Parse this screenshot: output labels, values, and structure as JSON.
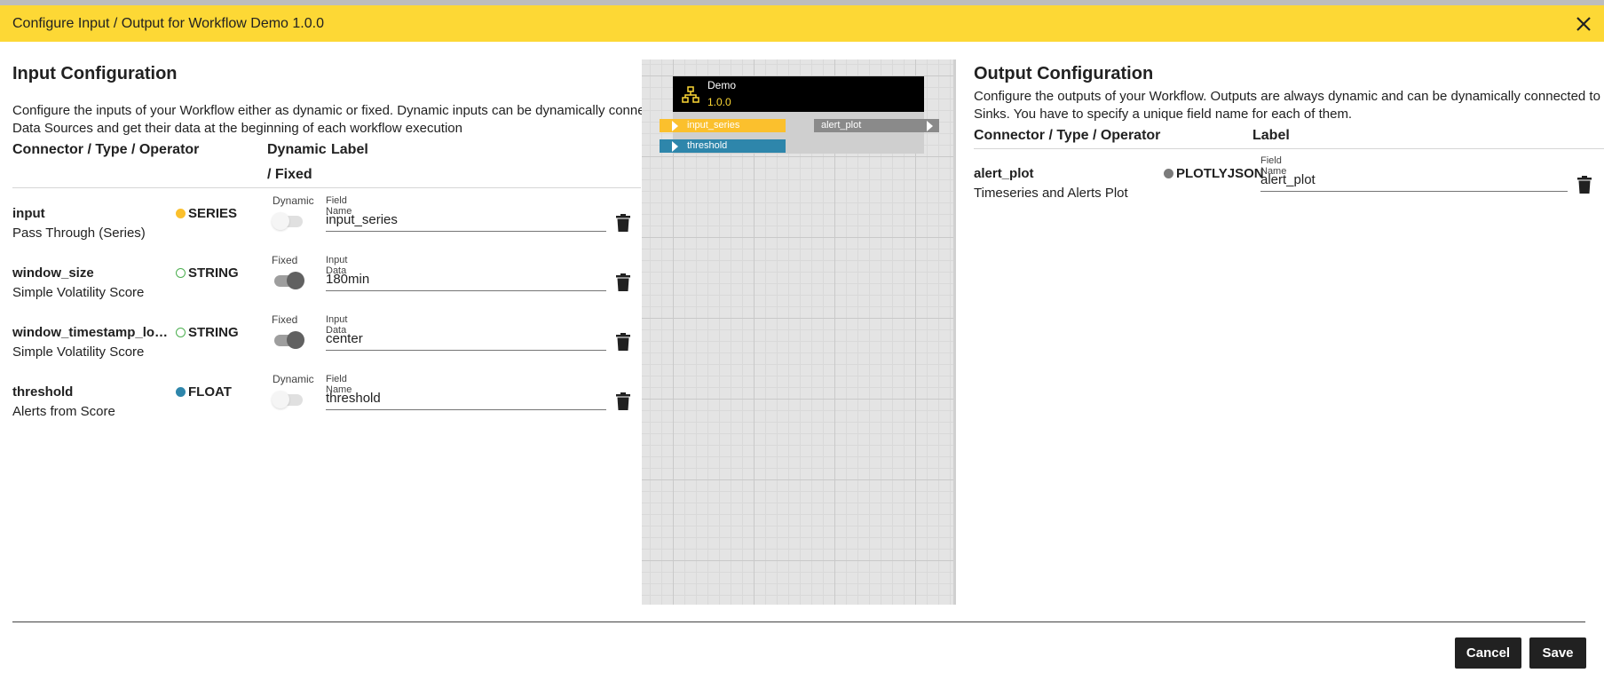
{
  "dialog": {
    "title": "Configure Input / Output for Workflow Demo 1.0.0"
  },
  "input_config": {
    "title": "Input Configuration",
    "description_line1": "Configure the inputs of your Workflow either as dynamic or fixed. Dynamic inputs can be dynamically connected to",
    "description_line2": "Data Sources and get their data at the beginning of each workflow execution",
    "headers": {
      "connector": "Connector / Type / Operator",
      "mode_line1": "Dynamic",
      "mode_line2": "/ Fixed",
      "label": "Label"
    },
    "rows": [
      {
        "name": "input",
        "operator": "Pass Through (Series)",
        "type": "SERIES",
        "type_color": "#fbc02d",
        "type_filled": true,
        "mode": "Dynamic",
        "mode_on": false,
        "field_label": "Field Name",
        "field_value": "input_series"
      },
      {
        "name": "window_size",
        "operator": "Simple Volatility Score",
        "type": "STRING",
        "type_color": "#4caf50",
        "type_filled": false,
        "mode": "Fixed",
        "mode_on": true,
        "field_label": "Input Data",
        "field_value": "180min"
      },
      {
        "name": "window_timestamp_locati...",
        "operator": "Simple Volatility Score",
        "type": "STRING",
        "type_color": "#4caf50",
        "type_filled": false,
        "mode": "Fixed",
        "mode_on": true,
        "field_label": "Input Data",
        "field_value": "center"
      },
      {
        "name": "threshold",
        "operator": "Alerts from Score",
        "type": "FLOAT",
        "type_color": "#2e86ab",
        "type_filled": true,
        "mode": "Dynamic",
        "mode_on": false,
        "field_label": "Field Name",
        "field_value": "threshold"
      }
    ]
  },
  "preview": {
    "node_name": "Demo",
    "node_version": "1.0.0",
    "inputs": [
      {
        "label": "input_series",
        "color": "#fbc02d"
      },
      {
        "label": "threshold",
        "color": "#2e86ab"
      }
    ],
    "outputs": [
      {
        "label": "alert_plot",
        "color": "#8a8a8a"
      }
    ]
  },
  "output_config": {
    "title": "Output Configuration",
    "description_line1": "Configure the outputs of your Workflow. Outputs are always dynamic and can be dynamically connected to Data",
    "description_line2": "Sinks. You have to specify a unique field name for each of them.",
    "headers": {
      "connector": "Connector / Type / Operator",
      "label": "Label"
    },
    "rows": [
      {
        "name": "alert_plot",
        "operator": "Timeseries and Alerts Plot",
        "type": "PLOTLYJSON",
        "type_color": "#7b7b7b",
        "type_filled": true,
        "field_label": "Field Name",
        "field_value": "alert_plot"
      }
    ]
  },
  "footer": {
    "cancel_label": "Cancel",
    "save_label": "Save"
  },
  "icons": {
    "close": "close-icon",
    "delete": "trash-icon",
    "workflow": "workflow-icon"
  }
}
